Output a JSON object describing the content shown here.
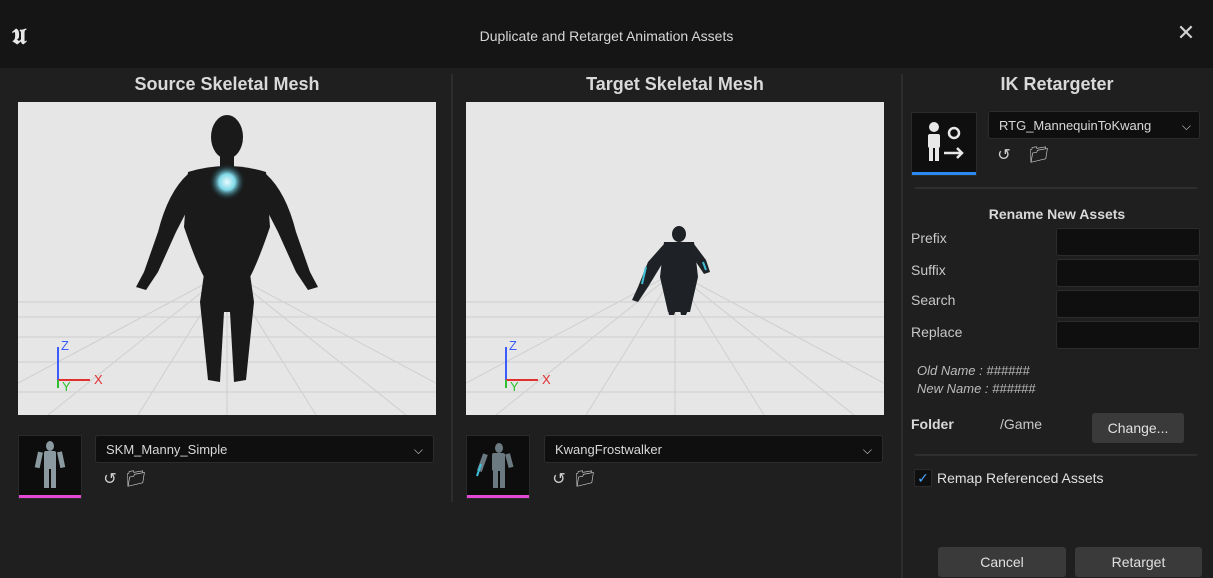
{
  "window": {
    "title": "Duplicate and Retarget Animation Assets",
    "logo_icon": "unreal-logo-icon",
    "logo_glyph": "𝖀",
    "close_icon": "close-icon",
    "close_glyph": "✕"
  },
  "source": {
    "title": "Source Skeletal Mesh",
    "mesh": "SKM_Manny_Simple",
    "axis_labels": {
      "z": "Z",
      "y": "Y",
      "x": "X"
    }
  },
  "target": {
    "title": "Target Skeletal Mesh",
    "mesh": "KwangFrostwalker",
    "axis_labels": {
      "z": "Z",
      "y": "Y",
      "x": "X"
    }
  },
  "retargeter": {
    "title": "IK Retargeter",
    "asset": "RTG_MannequinToKwang",
    "rename_header": "Rename New Assets",
    "prefix_label": "Prefix",
    "suffix_label": "Suffix",
    "search_label": "Search",
    "replace_label": "Replace",
    "prefix_value": "",
    "suffix_value": "",
    "search_value": "",
    "replace_value": "",
    "old_name": "Old Name : ######",
    "new_name": "New Name : ######",
    "folder_label": "Folder",
    "folder_value": "/Game",
    "change_button": "Change...",
    "remap_label": "Remap Referenced Assets",
    "remap_checked": true
  },
  "footer": {
    "cancel": "Cancel",
    "retarget": "Retarget"
  },
  "icons": {
    "dropdown": "chevron-down-icon",
    "use_selected": "arrow-left-circle-icon",
    "browse": "browse-folder-icon"
  },
  "colors": {
    "accent": "#4aa8ff",
    "thumb_bar": "#e24ad6",
    "retargeter_bar": "#2b8bf0",
    "background": "#1f1f1f",
    "titlebar": "#151515"
  }
}
